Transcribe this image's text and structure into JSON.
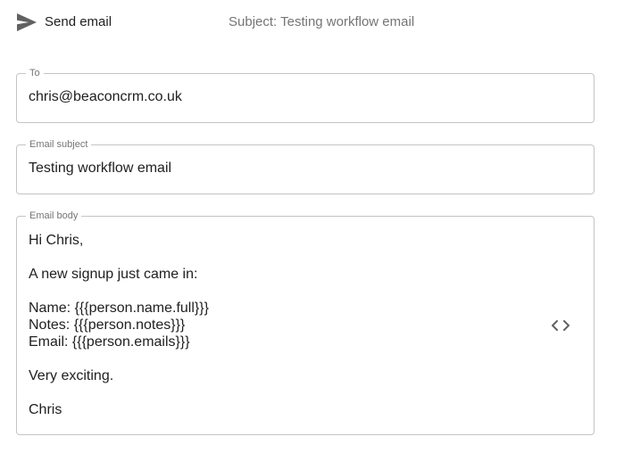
{
  "header": {
    "title": "Send email",
    "subject": "Subject: Testing workflow email",
    "icon": "send-icon"
  },
  "fields": {
    "to": {
      "label": "To",
      "value": "chris@beaconcrm.co.uk"
    },
    "subject": {
      "label": "Email subject",
      "value": "Testing workflow email"
    },
    "body": {
      "label": "Email body",
      "lines": [
        "Hi Chris,",
        "",
        "A new signup just came in:",
        "",
        "Name: {{{person.name.full}}}",
        "Notes: {{{person.notes}}}",
        "Email: {{{person.emails}}}",
        "",
        "Very exciting.",
        "",
        "Chris"
      ],
      "toggle_icon": "code-icon"
    }
  },
  "colors": {
    "border": "#c4c4c4",
    "label": "#757575",
    "text": "#212121",
    "icon": "#616161"
  }
}
